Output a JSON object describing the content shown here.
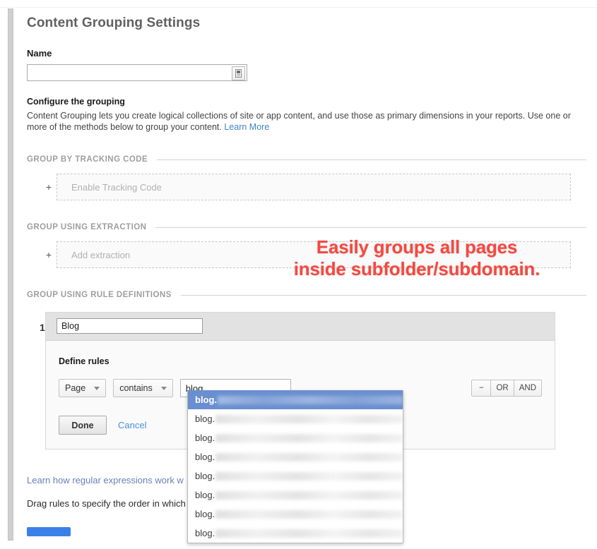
{
  "page": {
    "title": "Content Grouping Settings"
  },
  "name_field": {
    "label": "Name",
    "value": "",
    "placeholder": "",
    "autofill_icon": "autofill-icon"
  },
  "configure": {
    "heading": "Configure the grouping",
    "description": "Content Grouping lets you create logical collections of site or app content, and use those as primary dimensions in your reports. Use one or more of the methods below to group your content.",
    "link_label": "Learn More"
  },
  "sections": {
    "tracking_code": {
      "divider_label": "GROUP BY TRACKING CODE",
      "plus": "+",
      "add_label": "Enable Tracking Code"
    },
    "extraction": {
      "divider_label": "GROUP USING EXTRACTION",
      "plus": "+",
      "add_label": "Add extraction"
    },
    "rule_definitions": {
      "divider_label": "GROUP USING RULE DEFINITIONS"
    }
  },
  "rule": {
    "index": "1.",
    "name_value": "Blog",
    "define_rules_label": "Define rules",
    "dimension": "Page",
    "match_type": "contains",
    "value": "blog",
    "operators": {
      "remove": "−",
      "or": "OR",
      "and": "AND"
    },
    "done_label": "Done",
    "cancel_label": "Cancel"
  },
  "autocomplete": {
    "items": [
      {
        "prefix": "blog.",
        "selected": true
      },
      {
        "prefix": "blog.",
        "selected": false
      },
      {
        "prefix": "blog.",
        "selected": false
      },
      {
        "prefix": "blog.",
        "selected": false
      },
      {
        "prefix": "blog.",
        "selected": false
      },
      {
        "prefix": "blog.",
        "selected": false
      },
      {
        "prefix": "blog.",
        "selected": false
      },
      {
        "prefix": "blog.",
        "selected": false
      }
    ]
  },
  "footer": {
    "regex_link": "Learn how regular expressions work w",
    "drag_note": "Drag rules to specify the order in which",
    "save_label": ""
  },
  "annotation": {
    "line1": "Easily groups all pages",
    "line2": "inside subfolder/subdomain.",
    "color": "#f8473f"
  },
  "colors": {
    "link": "#4285c4",
    "accent_blue": "#3b80e8",
    "selected_row": "#6a8fd0",
    "annotation_red": "#f8473f"
  }
}
